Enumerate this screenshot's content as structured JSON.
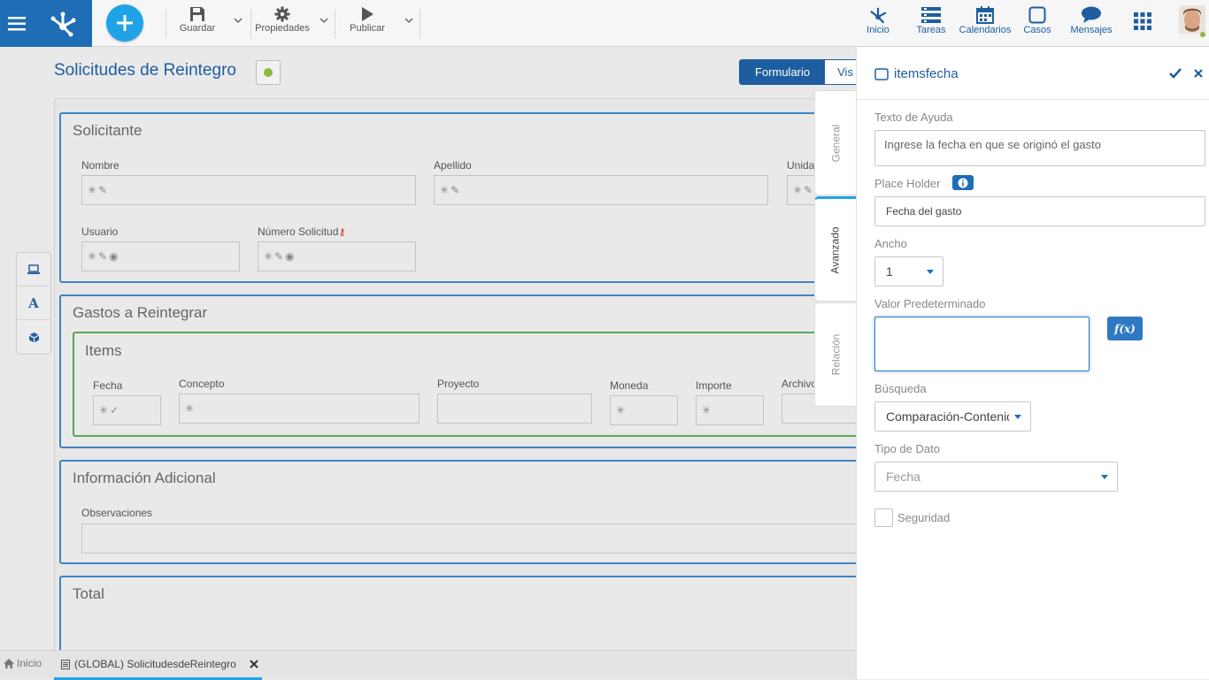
{
  "toolbar": {
    "save_label": "Guardar",
    "properties_label": "Propiedades",
    "publish_label": "Publicar"
  },
  "top_nav": [
    {
      "label": "Inicio",
      "icon": "home-network-icon"
    },
    {
      "label": "Tareas",
      "icon": "tasks-icon"
    },
    {
      "label": "Calendarios",
      "icon": "calendar-icon"
    },
    {
      "label": "Casos",
      "icon": "cases-icon"
    },
    {
      "label": "Mensajes",
      "icon": "message-icon"
    },
    {
      "label": "",
      "icon": "apps-grid-icon"
    }
  ],
  "colors": {
    "brand": "#1e6db5",
    "accent": "#1fa3e6",
    "section_border": "#3f84c4",
    "subsection_border": "#5aa55a",
    "status_ok": "#8cb83c"
  },
  "form": {
    "title": "Solicitudes de Reintegro",
    "view_tabs": [
      "Formulario",
      "Vis"
    ],
    "sections": {
      "solicitante": {
        "title": "Solicitante",
        "fields": {
          "nombre": "Nombre",
          "apellido": "Apellido",
          "unidad": "Unida",
          "usuario": "Usuario",
          "numero": "Número Solicitud"
        }
      },
      "gastos": {
        "title": "Gastos a Reintegrar",
        "items_title": "Items",
        "columns": [
          "Fecha",
          "Concepto",
          "Proyecto",
          "Moneda",
          "Importe",
          "Archivo"
        ]
      },
      "info": {
        "title": "Información Adicional",
        "observaciones": "Observaciones"
      },
      "total": {
        "title": "Total"
      }
    }
  },
  "side_tabs": [
    "General",
    "Avanzado",
    "Relación"
  ],
  "bottom": {
    "home_label": "Inicio",
    "tab_label": "(GLOBAL) SolicitudesdeReintegro"
  },
  "panel": {
    "title": "itemsfecha",
    "help_text_label": "Texto de Ayuda",
    "help_text_value": "Ingrese la fecha en que se originó el gasto",
    "placeholder_label": "Place Holder",
    "placeholder_value": "Fecha del gasto",
    "width_label": "Ancho",
    "width_value": "1",
    "default_label": "Valor Predeterminado",
    "default_value": "",
    "fx_label": "f(x)",
    "search_label": "Búsqueda",
    "search_value": "Comparación-Contenido",
    "datatype_label": "Tipo de Dato",
    "datatype_value": "Fecha",
    "security_label": "Seguridad"
  }
}
